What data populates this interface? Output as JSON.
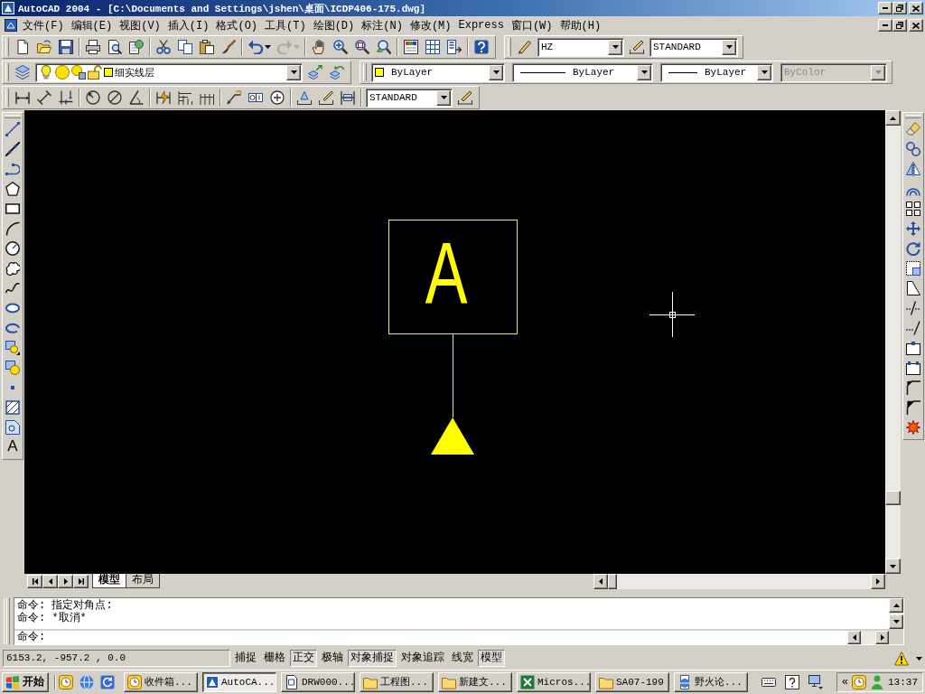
{
  "window": {
    "title": "AutoCAD 2004 - [C:\\Documents and Settings\\jshen\\桌面\\ICDP406-175.dwg]"
  },
  "menu": [
    "文件(F)",
    "编辑(E)",
    "视图(V)",
    "插入(I)",
    "格式(O)",
    "工具(T)",
    "绘图(D)",
    "标注(N)",
    "修改(M)",
    "Express",
    "窗口(W)",
    "帮助(H)"
  ],
  "standard_toolbar": {
    "redo_disabled": true
  },
  "styles_toolbar": {
    "text_style": "HZ",
    "dimension_style": "STANDARD"
  },
  "layers_toolbar": {
    "layer": {
      "name": "细实线层",
      "on": true,
      "frozen": false,
      "locked": false
    }
  },
  "properties_toolbar": {
    "object_color": "ByLayer",
    "linetype": "ByLayer",
    "lineweight": "ByLayer",
    "plot_style": {
      "value": "ByColor",
      "disabled": true
    }
  },
  "dimension_toolbar": {
    "dimension_style": "STANDARD"
  },
  "draw_toolbar": {
    "text_tool": "A"
  },
  "drawing": {
    "text": "A"
  },
  "layout_tabs": [
    {
      "label": "模型",
      "selected": true
    },
    {
      "label": "布局",
      "selected": false
    }
  ],
  "command_window": {
    "history": [
      "命令: 指定对角点:",
      "命令: *取消*"
    ],
    "prompt": "命令:"
  },
  "status_bar": {
    "coordinates": "6153.2, -957.2 , 0.0",
    "toggles": [
      {
        "label": "捕捉",
        "on": false
      },
      {
        "label": "栅格",
        "on": false
      },
      {
        "label": "正交",
        "on": true
      },
      {
        "label": "极轴",
        "on": false
      },
      {
        "label": "对象捕捉",
        "on": true
      },
      {
        "label": "对象追踪",
        "on": false
      },
      {
        "label": "线宽",
        "on": false
      },
      {
        "label": "模型",
        "on": true
      }
    ]
  },
  "taskbar": {
    "start": "开始",
    "tasks": [
      {
        "label": "收件箱...",
        "kind": "clock",
        "selected": false
      },
      {
        "label": "AutoCA...",
        "kind": "cad",
        "selected": true
      },
      {
        "label": "DRW000...",
        "kind": "document",
        "selected": false
      },
      {
        "label": "工程图...",
        "kind": "folder",
        "selected": false
      },
      {
        "label": "新建文...",
        "kind": "folder",
        "selected": false
      },
      {
        "label": "Micros...",
        "kind": "spreadsheet",
        "selected": false
      },
      {
        "label": "SA07-199",
        "kind": "folder",
        "selected": false
      },
      {
        "label": "野火论...",
        "kind": "browser",
        "selected": false
      }
    ],
    "tray_expand": "«",
    "clock": "13:37"
  }
}
